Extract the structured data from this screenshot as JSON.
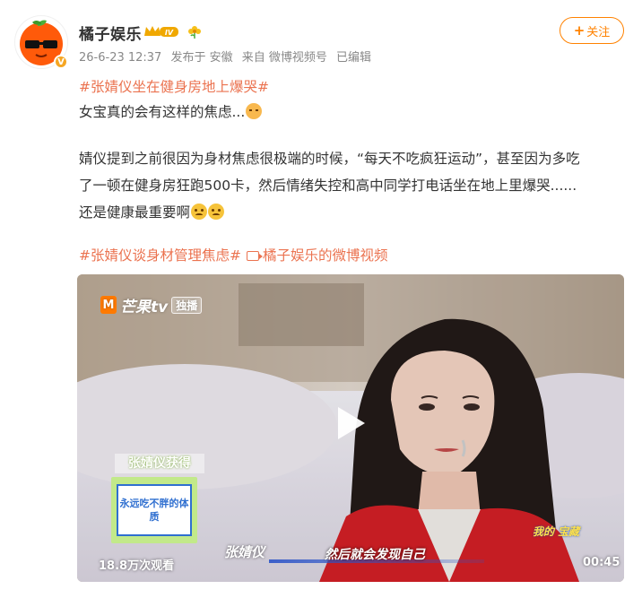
{
  "post": {
    "username": "橘子娱乐",
    "level_badge": "IV",
    "verified_mark": "V",
    "meta": {
      "date": "26-6-23 12:37",
      "published_at": "发布于 安徽",
      "source": "来自 微博视频号",
      "edited": "已编辑"
    },
    "follow_label": "关注",
    "follow_plus": "+",
    "hashtag_title": "#张婧仪坐在健身房地上爆哭#",
    "line2": "女宝真的会有这样的焦虑...",
    "paragraph_line1": "婧仪提到之前很因为身材焦虑很极端的时候，“每天不吃疯狂运动”，甚至因为多吃",
    "paragraph_line2": "了一顿在健身房狂跑500卡，然后情绪失控和高中同学打电话坐在地上里爆哭......",
    "paragraph_line3": "还是健康最重要啊",
    "hashtag_2": "#张婧仪谈身材管理焦虑#",
    "video_link": "橘子娱乐的微博视频"
  },
  "video": {
    "logo": "芒果tv",
    "logo_mark": "M",
    "logo_tag": "独播",
    "overlay_title": "张婧仪获得",
    "overlay_card": "永远吃不胖的体质",
    "subtitle_name": "张婧仪",
    "subtitle_text": "然后就会发现自己",
    "corner_logo": "我的 宝藏",
    "views": "18.8万次观看",
    "duration": "00:45"
  },
  "colors": {
    "accent": "#ff8200",
    "hashtag": "#eb7350",
    "meta": "#888888"
  },
  "icons": [
    "orange-avatar-icon",
    "crown-level-icon",
    "flower-icon",
    "play-icon",
    "video-link-icon",
    "cat-emoji-icon",
    "sad-emoji-icon"
  ]
}
